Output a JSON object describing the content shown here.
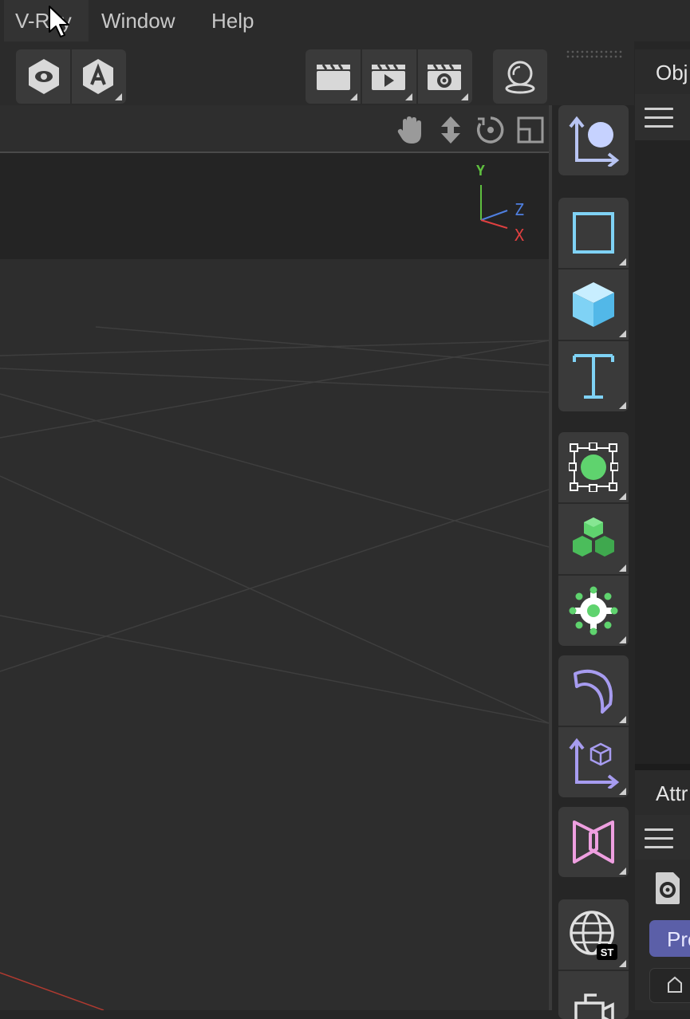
{
  "menu": {
    "items": [
      {
        "label": "V-Ray",
        "active": true
      },
      {
        "label": "Window",
        "active": false
      },
      {
        "label": "Help",
        "active": false
      }
    ]
  },
  "toolbar": {
    "groups": [
      {
        "buttons": [
          "view-mode-eye-icon",
          "auto-a-icon"
        ]
      },
      {
        "buttons": [
          "render-view-clapper-icon",
          "render-play-clapper-icon",
          "render-settings-clapper-icon"
        ]
      },
      {
        "buttons": [
          "vray-render-icon"
        ]
      }
    ]
  },
  "viewport": {
    "nav_icons": [
      "pan-hand-icon",
      "move-arrows-icon",
      "rotate-orbit-icon",
      "maximize-view-icon"
    ],
    "axis": {
      "y": "Y",
      "z": "Z",
      "x": "X"
    },
    "colors": {
      "y": "#5fbf3f",
      "z": "#4f7fe0",
      "x": "#e04040"
    }
  },
  "palette": {
    "icons": [
      "null-object-icon",
      "spline-rectangle-icon",
      "cube-primitive-icon",
      "text-spline-icon",
      "subdivision-generator-icon",
      "cloner-generator-icon",
      "effector-gear-icon",
      "deformer-bend-icon",
      "field-axis-icon",
      "scene-hourglass-icon",
      "vray-environment-icon",
      "camera-icon"
    ]
  },
  "right_panel": {
    "objects_tab": "Obj",
    "attributes_tab": "Attr",
    "project_label": "Pro"
  }
}
